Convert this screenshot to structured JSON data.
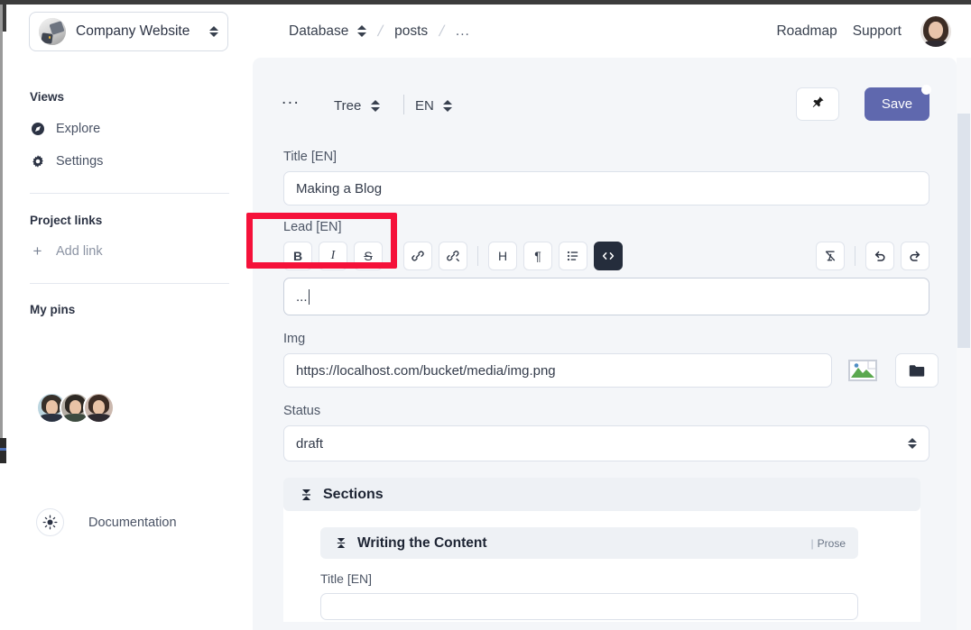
{
  "header": {
    "project_switcher": {
      "name": "Company Website",
      "avatar": "project-photo-avatar",
      "chevron": "updown-chevron-icon"
    },
    "breadcrumb": {
      "root": "Database",
      "separator": "/",
      "items": [
        "posts",
        "..."
      ]
    },
    "links": [
      "Roadmap",
      "Support"
    ],
    "user_avatar": "user-photo-avatar"
  },
  "sidebar": {
    "views_title": "Views",
    "views": [
      {
        "label": "Explore",
        "icon": "compass-icon"
      },
      {
        "label": "Settings",
        "icon": "gear-icon"
      }
    ],
    "project_links_title": "Project links",
    "add_link": {
      "label": "Add link",
      "icon": "plus-icon"
    },
    "my_pins_title": "My pins",
    "pins_avatars": [
      "member-avatar-1",
      "member-avatar-2",
      "member-avatar-3"
    ],
    "documentation": {
      "label": "Documentation",
      "icon": "sun-icon"
    }
  },
  "main": {
    "toolbar": {
      "more": "...",
      "view_mode": "Tree",
      "language": "EN",
      "pin_label": "pin-icon",
      "save_label": "Save",
      "save_has_changes": true
    },
    "fields": {
      "title": {
        "label": "Title [EN]",
        "value": "Making a Blog"
      },
      "lead": {
        "label": "Lead [EN]",
        "value": "..."
      },
      "img": {
        "label": "Img",
        "value": "https://localhost.com/bucket/media/img.png"
      },
      "status": {
        "label": "Status",
        "value": "draft"
      }
    },
    "editor_toolbar": [
      {
        "name": "bold-button",
        "glyph": "B",
        "style": "bold",
        "active": false
      },
      {
        "name": "italic-button",
        "glyph": "I",
        "style": "italic",
        "active": false
      },
      {
        "name": "strikethrough-button",
        "glyph": "S",
        "style": "strike",
        "active": false
      },
      {
        "name": "link-button",
        "glyph": "link-icon",
        "active": false
      },
      {
        "name": "unlink-button",
        "glyph": "unlink-icon",
        "active": false
      },
      {
        "name": "heading-button",
        "glyph": "H",
        "active": false
      },
      {
        "name": "paragraph-button",
        "glyph": "¶",
        "active": false
      },
      {
        "name": "bullet-list-button",
        "glyph": "list-icon",
        "active": false
      },
      {
        "name": "code-block-button",
        "glyph": "</>",
        "active": true
      },
      {
        "name": "clear-format-button",
        "glyph": "clear-format-icon",
        "active": false
      },
      {
        "name": "undo-button",
        "glyph": "undo-icon",
        "active": false
      },
      {
        "name": "redo-button",
        "glyph": "redo-icon",
        "active": false
      }
    ],
    "sections": {
      "title": "Sections",
      "collapse_icon": "collapse-icon",
      "children": [
        {
          "title": "Writing the Content",
          "type_label": "Prose",
          "collapse_icon": "collapse-icon",
          "fields": {
            "title": {
              "label": "Title [EN]",
              "value": ""
            }
          }
        }
      ]
    }
  },
  "colors": {
    "accent": "#5f68ae",
    "panel_bg": "#f4f6f9",
    "annotation": "#f5113a",
    "section_bg": "#eef1f5"
  }
}
